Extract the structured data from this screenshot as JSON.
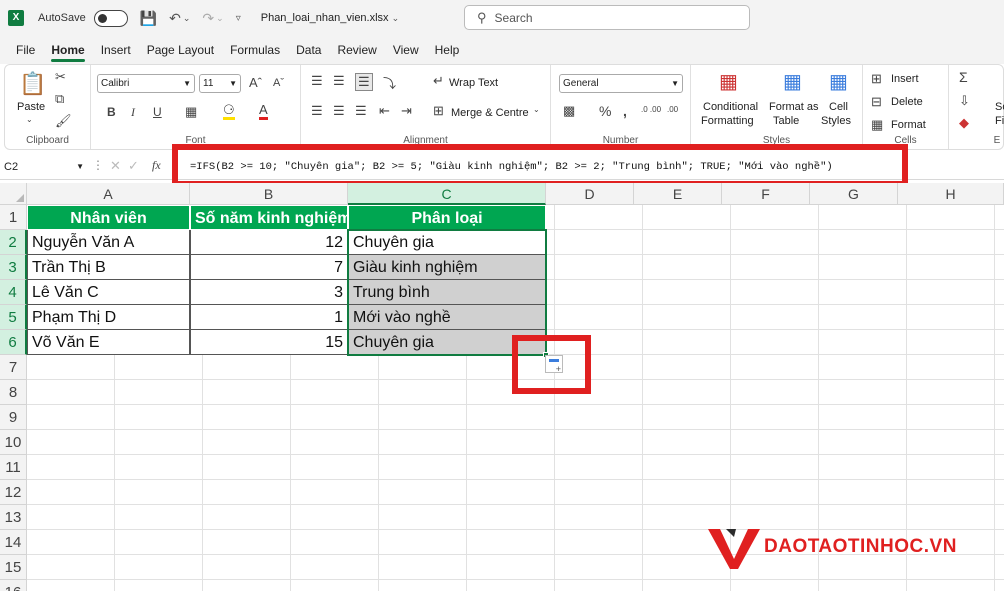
{
  "titlebar": {
    "app_icon": "X",
    "autosave_label": "AutoSave",
    "filename": "Phan_loai_nhan_vien.xlsx",
    "search_placeholder": "Search"
  },
  "menu": {
    "tabs": [
      "File",
      "Home",
      "Insert",
      "Page Layout",
      "Formulas",
      "Data",
      "Review",
      "View",
      "Help"
    ],
    "active": "Home"
  },
  "ribbon": {
    "clipboard": {
      "paste": "Paste",
      "label": "Clipboard"
    },
    "font": {
      "name": "Calibri",
      "size": "11",
      "bold": "B",
      "italic": "I",
      "underline": "U",
      "label": "Font"
    },
    "alignment": {
      "wrap": "Wrap Text",
      "merge": "Merge & Centre",
      "label": "Alignment"
    },
    "number": {
      "format": "General",
      "label": "Number"
    },
    "styles": {
      "conditional": "Conditional",
      "conditional2": "Formatting",
      "format_as": "Format as",
      "format_as2": "Table",
      "cell": "Cell",
      "cell2": "Styles",
      "label": "Styles"
    },
    "cells": {
      "insert": "Insert",
      "delete": "Delete",
      "format": "Format",
      "label": "Cells"
    },
    "editing": {
      "sort": "So",
      "filter": "Filt",
      "label": "E"
    }
  },
  "formula_bar": {
    "name_box": "C2",
    "fx": "fx",
    "formula": "=IFS(B2 >= 10; \"Chuyên gia\"; B2 >= 5; \"Giàu kinh nghiệm\"; B2 >= 2; \"Trung bình\"; TRUE; \"Mới vào nghề\")"
  },
  "sheet": {
    "columns": [
      "A",
      "B",
      "C",
      "D",
      "E",
      "F",
      "G",
      "H"
    ],
    "rows": [
      "1",
      "2",
      "3",
      "4",
      "5",
      "6",
      "7",
      "8",
      "9",
      "10",
      "11",
      "12",
      "13",
      "14",
      "15",
      "16"
    ],
    "headers": [
      "Nhân viên",
      "Số năm kinh nghiệm",
      "Phân loại"
    ],
    "data": [
      {
        "name": "Nguyễn Văn A",
        "years": "12",
        "category": "Chuyên gia"
      },
      {
        "name": "Trần Thị B",
        "years": "7",
        "category": "Giàu kinh nghiệm"
      },
      {
        "name": "Lê Văn C",
        "years": "3",
        "category": "Trung bình"
      },
      {
        "name": "Phạm Thị D",
        "years": "1",
        "category": "Mới vào nghề"
      },
      {
        "name": "Võ Văn E",
        "years": "15",
        "category": "Chuyên gia"
      }
    ],
    "header_color": "#00a651",
    "selection_color": "#107c41"
  },
  "watermark": {
    "text": "DAOTAOTINHOC.VN",
    "color": "#e02020"
  }
}
